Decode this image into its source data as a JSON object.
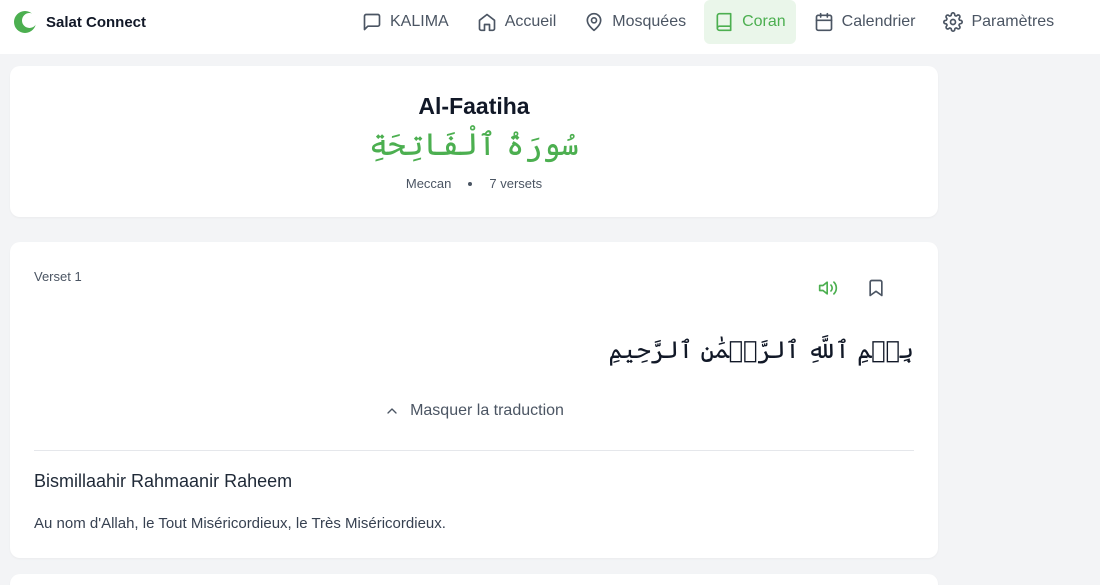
{
  "app": {
    "name": "Salat Connect"
  },
  "nav": {
    "items": [
      {
        "label": "KALIMA",
        "icon": "message-square-icon",
        "active": false
      },
      {
        "label": "Accueil",
        "icon": "home-icon",
        "active": false
      },
      {
        "label": "Mosquées",
        "icon": "map-pin-icon",
        "active": false
      },
      {
        "label": "Coran",
        "icon": "book-icon",
        "active": true
      },
      {
        "label": "Calendrier",
        "icon": "calendar-icon",
        "active": false
      },
      {
        "label": "Paramètres",
        "icon": "settings-icon",
        "active": false
      }
    ]
  },
  "surah": {
    "name": "Al-Faatiha",
    "arabic": "سُورَةُ ٱلْفَاتِحَةِ",
    "revelation": "Meccan",
    "verses_count": "7 versets"
  },
  "verse": {
    "label": "Verset 1",
    "arabic": "بِسۡمِ ٱللَّهِ ٱلرَّحۡمَٰنِ ٱلرَّحِيمِ",
    "toggle_label": "Masquer la traduction",
    "transliteration": "Bismillaahir Rahmaanir Raheem",
    "translation": "Au nom d'Allah, le Tout Miséricordieux, le Très Miséricordieux."
  },
  "colors": {
    "accent": "#4caf50",
    "accent_bg": "#eaf6ea",
    "page_bg": "#f3f4f6",
    "text": "#111827",
    "muted": "#4b5563"
  }
}
